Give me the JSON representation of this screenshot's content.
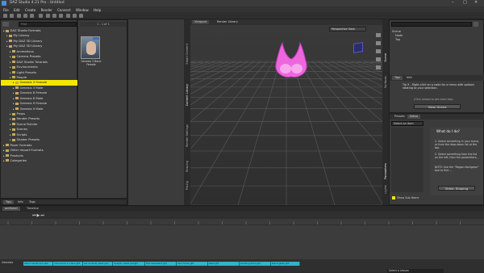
{
  "window": {
    "title": "DAZ Studio 4.21 Pro - Untitled"
  },
  "menu": [
    "File",
    "Edit",
    "Create",
    "Render",
    "Connect",
    "Window",
    "Help"
  ],
  "content_library": {
    "search_placeholder": "Find",
    "tree": [
      {
        "label": "DAZ Studio Formats",
        "level": 0
      },
      {
        "label": "My Library",
        "level": 1
      },
      {
        "label": "My DAZ 3D Library",
        "level": 1
      },
      {
        "label": "My DAZ 3D Library",
        "level": 1
      },
      {
        "label": "Animations",
        "level": 2
      },
      {
        "label": "Camera Presets",
        "level": 2
      },
      {
        "label": "DAZ Studio Tutorials",
        "level": 2
      },
      {
        "label": "Environments",
        "level": 2
      },
      {
        "label": "Light Presets",
        "level": 2
      },
      {
        "label": "People",
        "level": 2
      },
      {
        "label": "Genesis 3 Female",
        "level": 3,
        "selected": true
      },
      {
        "label": "Genesis 3 Male",
        "level": 3
      },
      {
        "label": "Genesis 8 Female",
        "level": 3
      },
      {
        "label": "Genesis 8 Male",
        "level": 3
      },
      {
        "label": "Genesis 9 Female",
        "level": 3
      },
      {
        "label": "Genesis 9 Male",
        "level": 3
      },
      {
        "label": "Props",
        "level": 2
      },
      {
        "label": "Render Presets",
        "level": 2
      },
      {
        "label": "Scene Builder",
        "level": 2
      },
      {
        "label": "Scenes",
        "level": 2
      },
      {
        "label": "Scripts",
        "level": 2
      },
      {
        "label": "Shader Presets",
        "level": 2
      },
      {
        "label": "Poser Formats",
        "level": 0
      },
      {
        "label": "Other Import Formats",
        "level": 0
      },
      {
        "label": "Products",
        "level": 0
      },
      {
        "label": "Categories",
        "level": 0
      }
    ],
    "paging": "1 - 1 of 1",
    "thumb_label": "Genesis 3 Basic Female",
    "tabs": [
      "Tips",
      "Info",
      "Tags"
    ]
  },
  "left_vtabs": [
    "Smart Content",
    "Content Library",
    "Render Settings",
    "Shaping",
    "Posing",
    "Tool Settings"
  ],
  "viewport": {
    "tabs": [
      "Viewport",
      "Render Library"
    ],
    "view_menu": "Perspective View"
  },
  "scene": {
    "search_placeholder": "",
    "items": [
      "Scene",
      "Node",
      "Top"
    ],
    "tabs": [
      "Tips",
      "Info"
    ],
    "tip_text": "Tip 9 - Right-click on a node for a menu with options relating to your selection.",
    "more_tips": "(Click arrows to see more tips)",
    "view_scene_button": "View: Scene"
  },
  "params": {
    "tabs": [
      "Presets",
      "Editor"
    ],
    "select_label": "Select an item",
    "what_do_i_do": "What do I do?",
    "step1": "1. Select something in your scene, or from the drop-down list at the top.",
    "step2": "2. Select something from the list on the left, then the parameters...",
    "note": "NOTE: Use the \"Region Navigator\" tool to find ...",
    "video_button": "Video: Shaping",
    "show_subitems": "Show Sub Items"
  },
  "right_vtabs": [
    "Scene",
    "Surfaces",
    "Parameters",
    "Lights",
    "Cameras"
  ],
  "timeline": {
    "tabs": [
      "aniMate2",
      "Timeline"
    ],
    "clips": [
      "blend mouth and jaw",
      "ride dance in place gt3",
      "bar musical jewel jam",
      "snappin jewel jamgt3",
      "flick backward gt3",
      "bind horse gt3",
      "twist gt3",
      "taunting arms gt3",
      "stand glass gt3"
    ],
    "left_label": "Genesis",
    "lesson_label": "Select a Lesson"
  },
  "colors": {
    "selection": "#f5e600",
    "prop_pink": "#ee66dd",
    "clip_cyan": "#2fb4c8",
    "clip_red": "#e04050"
  }
}
